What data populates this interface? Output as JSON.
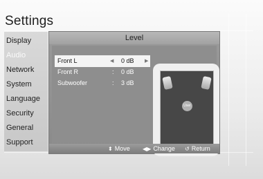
{
  "header": {
    "title": "Settings"
  },
  "sidebar": {
    "items": [
      {
        "label": "Display"
      },
      {
        "label": "Audio"
      },
      {
        "label": "Network"
      },
      {
        "label": "System"
      },
      {
        "label": "Language"
      },
      {
        "label": "Security"
      },
      {
        "label": "General"
      },
      {
        "label": "Support"
      }
    ]
  },
  "dialog": {
    "title": "Level",
    "rows": [
      {
        "label": "Front L",
        "value": "0 dB"
      },
      {
        "label": "Front R",
        "colon": ":",
        "value": "0 dB"
      },
      {
        "label": "Subwoofer",
        "colon": ":",
        "value": "3 dB"
      }
    ],
    "speaker_panel": {
      "user_label": "User"
    },
    "footer": {
      "move": "Move",
      "change": "Change",
      "return": "Return"
    }
  }
}
